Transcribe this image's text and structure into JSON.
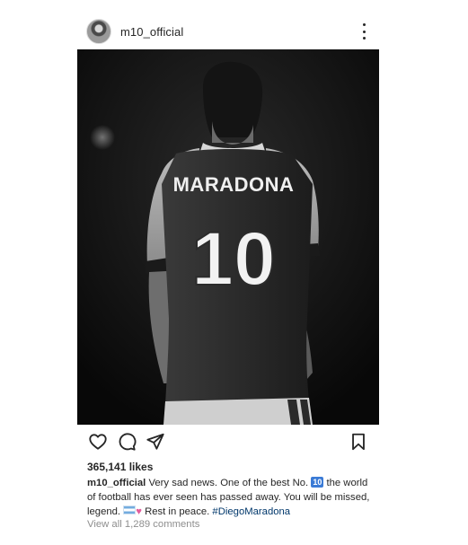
{
  "post": {
    "username": "m10_official",
    "likes": "365,141 likes",
    "caption": {
      "username": "m10_official",
      "text_part1": "Very sad news. One of the best No.",
      "emoji_ten": "10",
      "text_part2": "the world of football has ever seen has passed away. You will be missed, legend.",
      "text_part3": "Rest in peace.",
      "hashtag": "#DiegoMaradona"
    },
    "view_comments": "View all 1,289 comments"
  },
  "jersey": {
    "name": "MARADONA",
    "number": "10"
  },
  "icons": {
    "more": "more-options-icon",
    "like": "heart-icon",
    "comment": "comment-icon",
    "share": "send-icon",
    "save": "bookmark-icon"
  },
  "colors": {
    "text": "#262626",
    "muted": "#8e8e8e",
    "hashtag": "#00376b"
  }
}
